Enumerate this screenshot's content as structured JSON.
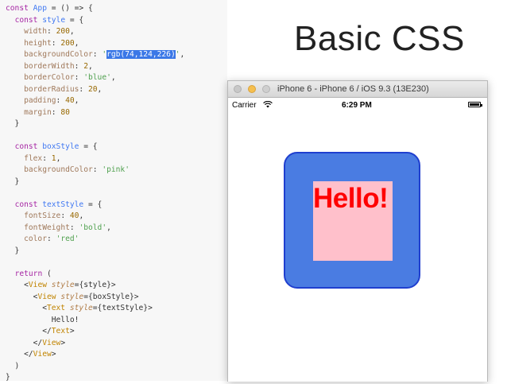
{
  "code_lines": [
    [
      {
        "t": "const ",
        "c": "kw"
      },
      {
        "t": "App",
        "c": "var"
      },
      {
        "t": " = () => {",
        "c": ""
      }
    ],
    [
      {
        "t": "  ",
        "c": ""
      },
      {
        "t": "const ",
        "c": "kw"
      },
      {
        "t": "style",
        "c": "var"
      },
      {
        "t": " = {",
        "c": ""
      }
    ],
    [
      {
        "t": "    ",
        "c": ""
      },
      {
        "t": "width",
        "c": "prop"
      },
      {
        "t": ": ",
        "c": ""
      },
      {
        "t": "200",
        "c": "num"
      },
      {
        "t": ",",
        "c": ""
      }
    ],
    [
      {
        "t": "    ",
        "c": ""
      },
      {
        "t": "height",
        "c": "prop"
      },
      {
        "t": ": ",
        "c": ""
      },
      {
        "t": "200",
        "c": "num"
      },
      {
        "t": ",",
        "c": ""
      }
    ],
    [
      {
        "t": "    ",
        "c": ""
      },
      {
        "t": "backgroundColor",
        "c": "prop"
      },
      {
        "t": ": ",
        "c": ""
      },
      {
        "t": "'",
        "c": "str"
      },
      {
        "t": "rgb(74,124,226)",
        "c": "hl"
      },
      {
        "t": "'",
        "c": "str"
      },
      {
        "t": ",",
        "c": ""
      }
    ],
    [
      {
        "t": "    ",
        "c": ""
      },
      {
        "t": "borderWidth",
        "c": "prop"
      },
      {
        "t": ": ",
        "c": ""
      },
      {
        "t": "2",
        "c": "num"
      },
      {
        "t": ",",
        "c": ""
      }
    ],
    [
      {
        "t": "    ",
        "c": ""
      },
      {
        "t": "borderColor",
        "c": "prop"
      },
      {
        "t": ": ",
        "c": ""
      },
      {
        "t": "'blue'",
        "c": "str"
      },
      {
        "t": ",",
        "c": ""
      }
    ],
    [
      {
        "t": "    ",
        "c": ""
      },
      {
        "t": "borderRadius",
        "c": "prop"
      },
      {
        "t": ": ",
        "c": ""
      },
      {
        "t": "20",
        "c": "num"
      },
      {
        "t": ",",
        "c": ""
      }
    ],
    [
      {
        "t": "    ",
        "c": ""
      },
      {
        "t": "padding",
        "c": "prop"
      },
      {
        "t": ": ",
        "c": ""
      },
      {
        "t": "40",
        "c": "num"
      },
      {
        "t": ",",
        "c": ""
      }
    ],
    [
      {
        "t": "    ",
        "c": ""
      },
      {
        "t": "margin",
        "c": "prop"
      },
      {
        "t": ": ",
        "c": ""
      },
      {
        "t": "80",
        "c": "num"
      }
    ],
    [
      {
        "t": "  }",
        "c": ""
      }
    ],
    [],
    [
      {
        "t": "  ",
        "c": ""
      },
      {
        "t": "const ",
        "c": "kw"
      },
      {
        "t": "boxStyle",
        "c": "var"
      },
      {
        "t": " = {",
        "c": ""
      }
    ],
    [
      {
        "t": "    ",
        "c": ""
      },
      {
        "t": "flex",
        "c": "prop"
      },
      {
        "t": ": ",
        "c": ""
      },
      {
        "t": "1",
        "c": "num"
      },
      {
        "t": ",",
        "c": ""
      }
    ],
    [
      {
        "t": "    ",
        "c": ""
      },
      {
        "t": "backgroundColor",
        "c": "prop"
      },
      {
        "t": ": ",
        "c": ""
      },
      {
        "t": "'pink'",
        "c": "str"
      }
    ],
    [
      {
        "t": "  }",
        "c": ""
      }
    ],
    [],
    [
      {
        "t": "  ",
        "c": ""
      },
      {
        "t": "const ",
        "c": "kw"
      },
      {
        "t": "textStyle",
        "c": "var"
      },
      {
        "t": " = {",
        "c": ""
      }
    ],
    [
      {
        "t": "    ",
        "c": ""
      },
      {
        "t": "fontSize",
        "c": "prop"
      },
      {
        "t": ": ",
        "c": ""
      },
      {
        "t": "40",
        "c": "num"
      },
      {
        "t": ",",
        "c": ""
      }
    ],
    [
      {
        "t": "    ",
        "c": ""
      },
      {
        "t": "fontWeight",
        "c": "prop"
      },
      {
        "t": ": ",
        "c": ""
      },
      {
        "t": "'bold'",
        "c": "str"
      },
      {
        "t": ",",
        "c": ""
      }
    ],
    [
      {
        "t": "    ",
        "c": ""
      },
      {
        "t": "color",
        "c": "prop"
      },
      {
        "t": ": ",
        "c": ""
      },
      {
        "t": "'red'",
        "c": "str"
      }
    ],
    [
      {
        "t": "  }",
        "c": ""
      }
    ],
    [],
    [
      {
        "t": "  ",
        "c": ""
      },
      {
        "t": "return ",
        "c": "kw"
      },
      {
        "t": "(",
        "c": ""
      }
    ],
    [
      {
        "t": "    <",
        "c": ""
      },
      {
        "t": "View ",
        "c": "tag"
      },
      {
        "t": "style",
        "c": "attr"
      },
      {
        "t": "={style}>",
        "c": ""
      }
    ],
    [
      {
        "t": "      <",
        "c": ""
      },
      {
        "t": "View ",
        "c": "tag"
      },
      {
        "t": "style",
        "c": "attr"
      },
      {
        "t": "={boxStyle}>",
        "c": ""
      }
    ],
    [
      {
        "t": "        <",
        "c": ""
      },
      {
        "t": "Text ",
        "c": "tag"
      },
      {
        "t": "style",
        "c": "attr"
      },
      {
        "t": "={textStyle}>",
        "c": ""
      }
    ],
    [
      {
        "t": "          Hello!",
        "c": ""
      }
    ],
    [
      {
        "t": "        </",
        "c": ""
      },
      {
        "t": "Text",
        "c": "tag"
      },
      {
        "t": ">",
        "c": ""
      }
    ],
    [
      {
        "t": "      </",
        "c": ""
      },
      {
        "t": "View",
        "c": "tag"
      },
      {
        "t": ">",
        "c": ""
      }
    ],
    [
      {
        "t": "    </",
        "c": ""
      },
      {
        "t": "View",
        "c": "tag"
      },
      {
        "t": ">",
        "c": ""
      }
    ],
    [
      {
        "t": "  )",
        "c": ""
      }
    ],
    [
      {
        "t": "}",
        "c": ""
      }
    ]
  ],
  "slide_title": "Basic CSS",
  "simulator": {
    "window_title": "iPhone 6 - iPhone 6 / iOS 9.3 (13E230)",
    "carrier": "Carrier",
    "time": "6:29 PM",
    "hello_text": "Hello!"
  },
  "colors": {
    "outer_view_bg": "#4a7ce2",
    "inner_view_bg": "pink",
    "text_color": "red"
  }
}
